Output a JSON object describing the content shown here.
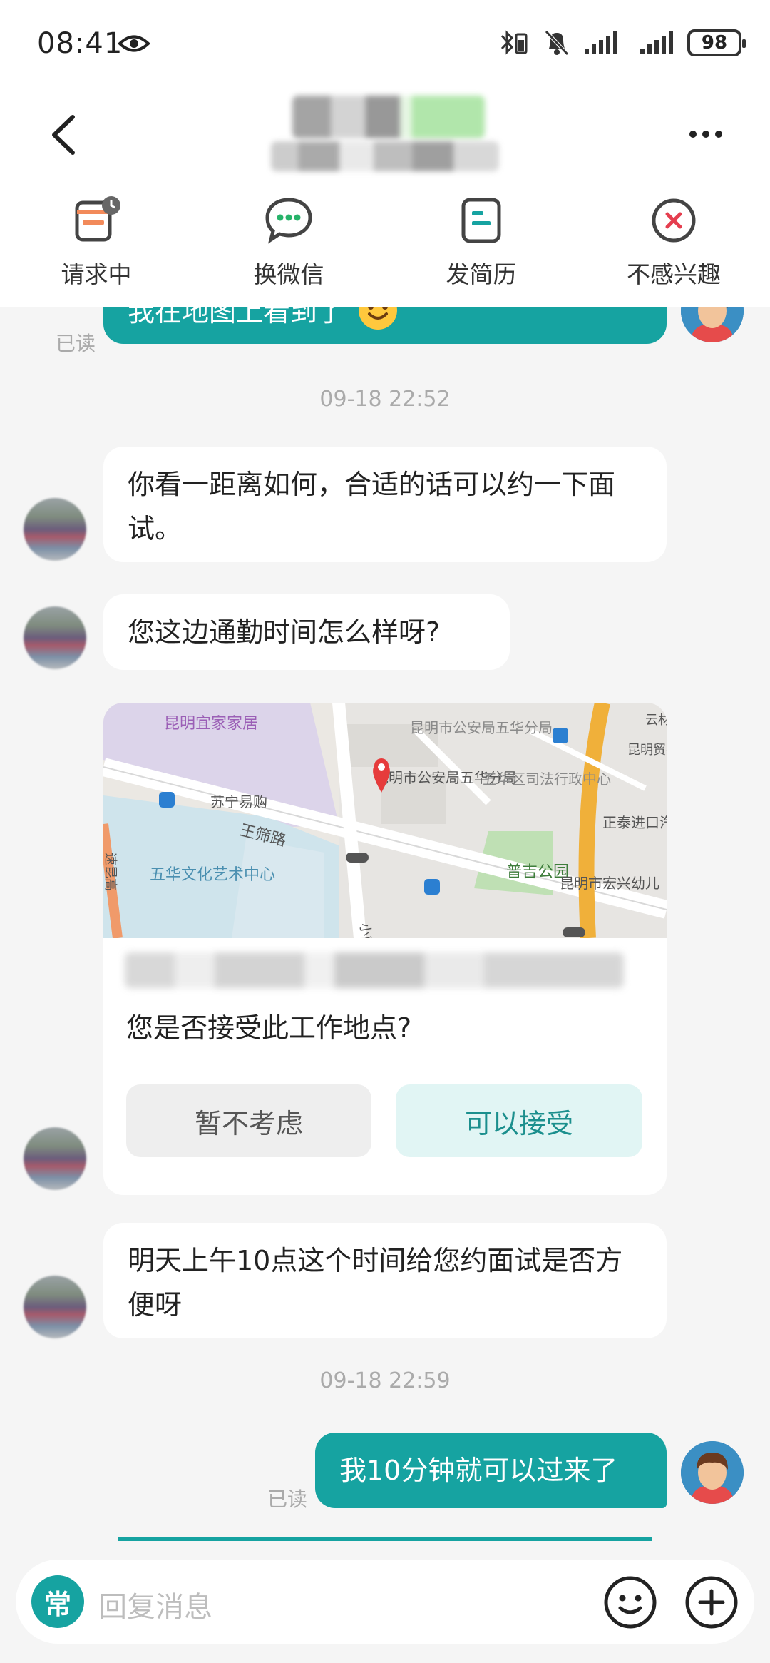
{
  "status_bar": {
    "time": "08:41",
    "battery": "98"
  },
  "actions": [
    {
      "label": "请求中",
      "icon": "request-pending-icon"
    },
    {
      "label": "换微信",
      "icon": "wechat-icon"
    },
    {
      "label": "发简历",
      "icon": "resume-icon"
    },
    {
      "label": "不感兴趣",
      "icon": "not-interested-icon"
    }
  ],
  "messages": {
    "m0": {
      "text": "我在地图上看到了",
      "read": "已读"
    },
    "ts1": "09-18 22:52",
    "m1": "你看一距离如何，合适的话可以约一下面试。",
    "m2": "您这边通勤时间怎么样呀?",
    "map_card": {
      "map_labels": {
        "l1": "昆明宜家家居",
        "l2": "昆明市公安局五华分局",
        "l3": "昆明市公安局五华分局",
        "l4": "五华区司法行政中心",
        "l5": "苏宁易购",
        "l6": "王筛路",
        "l7": "五华文化艺术中心",
        "l8": "普吉公园",
        "l9": "正泰进口汽车修理",
        "l10": "昆明市宏兴幼儿",
        "l11": "昆明贸有",
        "l12": "云材",
        "l13": "小屯",
        "l14": "速昆高"
      },
      "question": "您是否接受此工作地点?",
      "decline_label": "暂不考虑",
      "accept_label": "可以接受"
    },
    "m3": "明天上午10点这个时间给您约面试是否方便呀",
    "ts2": "09-18 22:59",
    "m4": {
      "text": "我10分钟就可以过来了",
      "read": "已读"
    }
  },
  "input": {
    "chang_label": "常",
    "placeholder": "回复消息"
  },
  "colors": {
    "accent": "#16a3a1",
    "accent_light": "#e1f5f4",
    "background": "#f5f5f5"
  }
}
